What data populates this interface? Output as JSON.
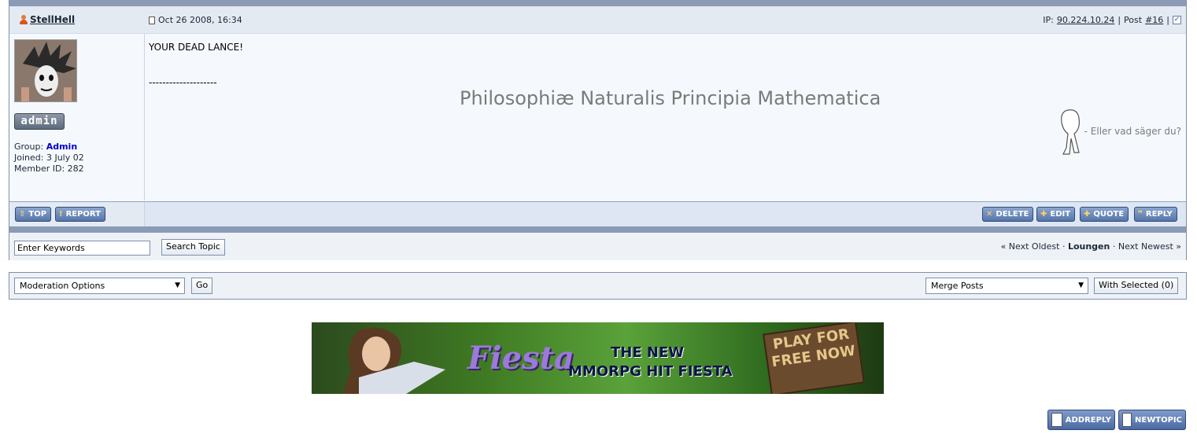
{
  "post": {
    "author": "StellHell",
    "date": "Oct 26 2008, 16:34",
    "ip_label": "IP:",
    "ip": "90.224.10.24",
    "post_label": "Post",
    "post_number": "#16",
    "group_label": "Group:",
    "group_value": "Admin",
    "joined": "Joined: 3 July 02",
    "member_id": "Member ID: 282",
    "badge": "admin",
    "body": "YOUR DEAD LANCE!",
    "sig_dash": "--------------------",
    "sig_title": "Philosophiæ Naturalis Principia Mathematica",
    "sig_aside": "- Eller vad säger du?"
  },
  "post_buttons": {
    "top": "TOP",
    "report": "REPORT",
    "delete": "DELETE",
    "edit": "EDIT",
    "quote": "QUOTE",
    "reply": "REPLY"
  },
  "search": {
    "keywords_value": "Enter Keywords",
    "button": "Search Topic"
  },
  "topic_nav": {
    "prev": "« Next Oldest",
    "sep": "·",
    "forum": "Loungen",
    "next": "Next Newest »"
  },
  "moderation": {
    "select": "Moderation Options",
    "go": "Go",
    "merge_select": "Merge Posts",
    "with_selected": "With Selected (0)"
  },
  "banner": {
    "logo": "Fiesta",
    "line1": "THE NEW",
    "line2": "MMORPG HIT FIESTA",
    "sign": "PLAY FOR FREE NOW"
  },
  "actions": {
    "add_reply": "ADDREPLY",
    "new_topic": "NEWTOPIC"
  },
  "colors": {
    "bar": "#8b9bb6",
    "button": "#5675a8",
    "group": "#0000cc"
  }
}
